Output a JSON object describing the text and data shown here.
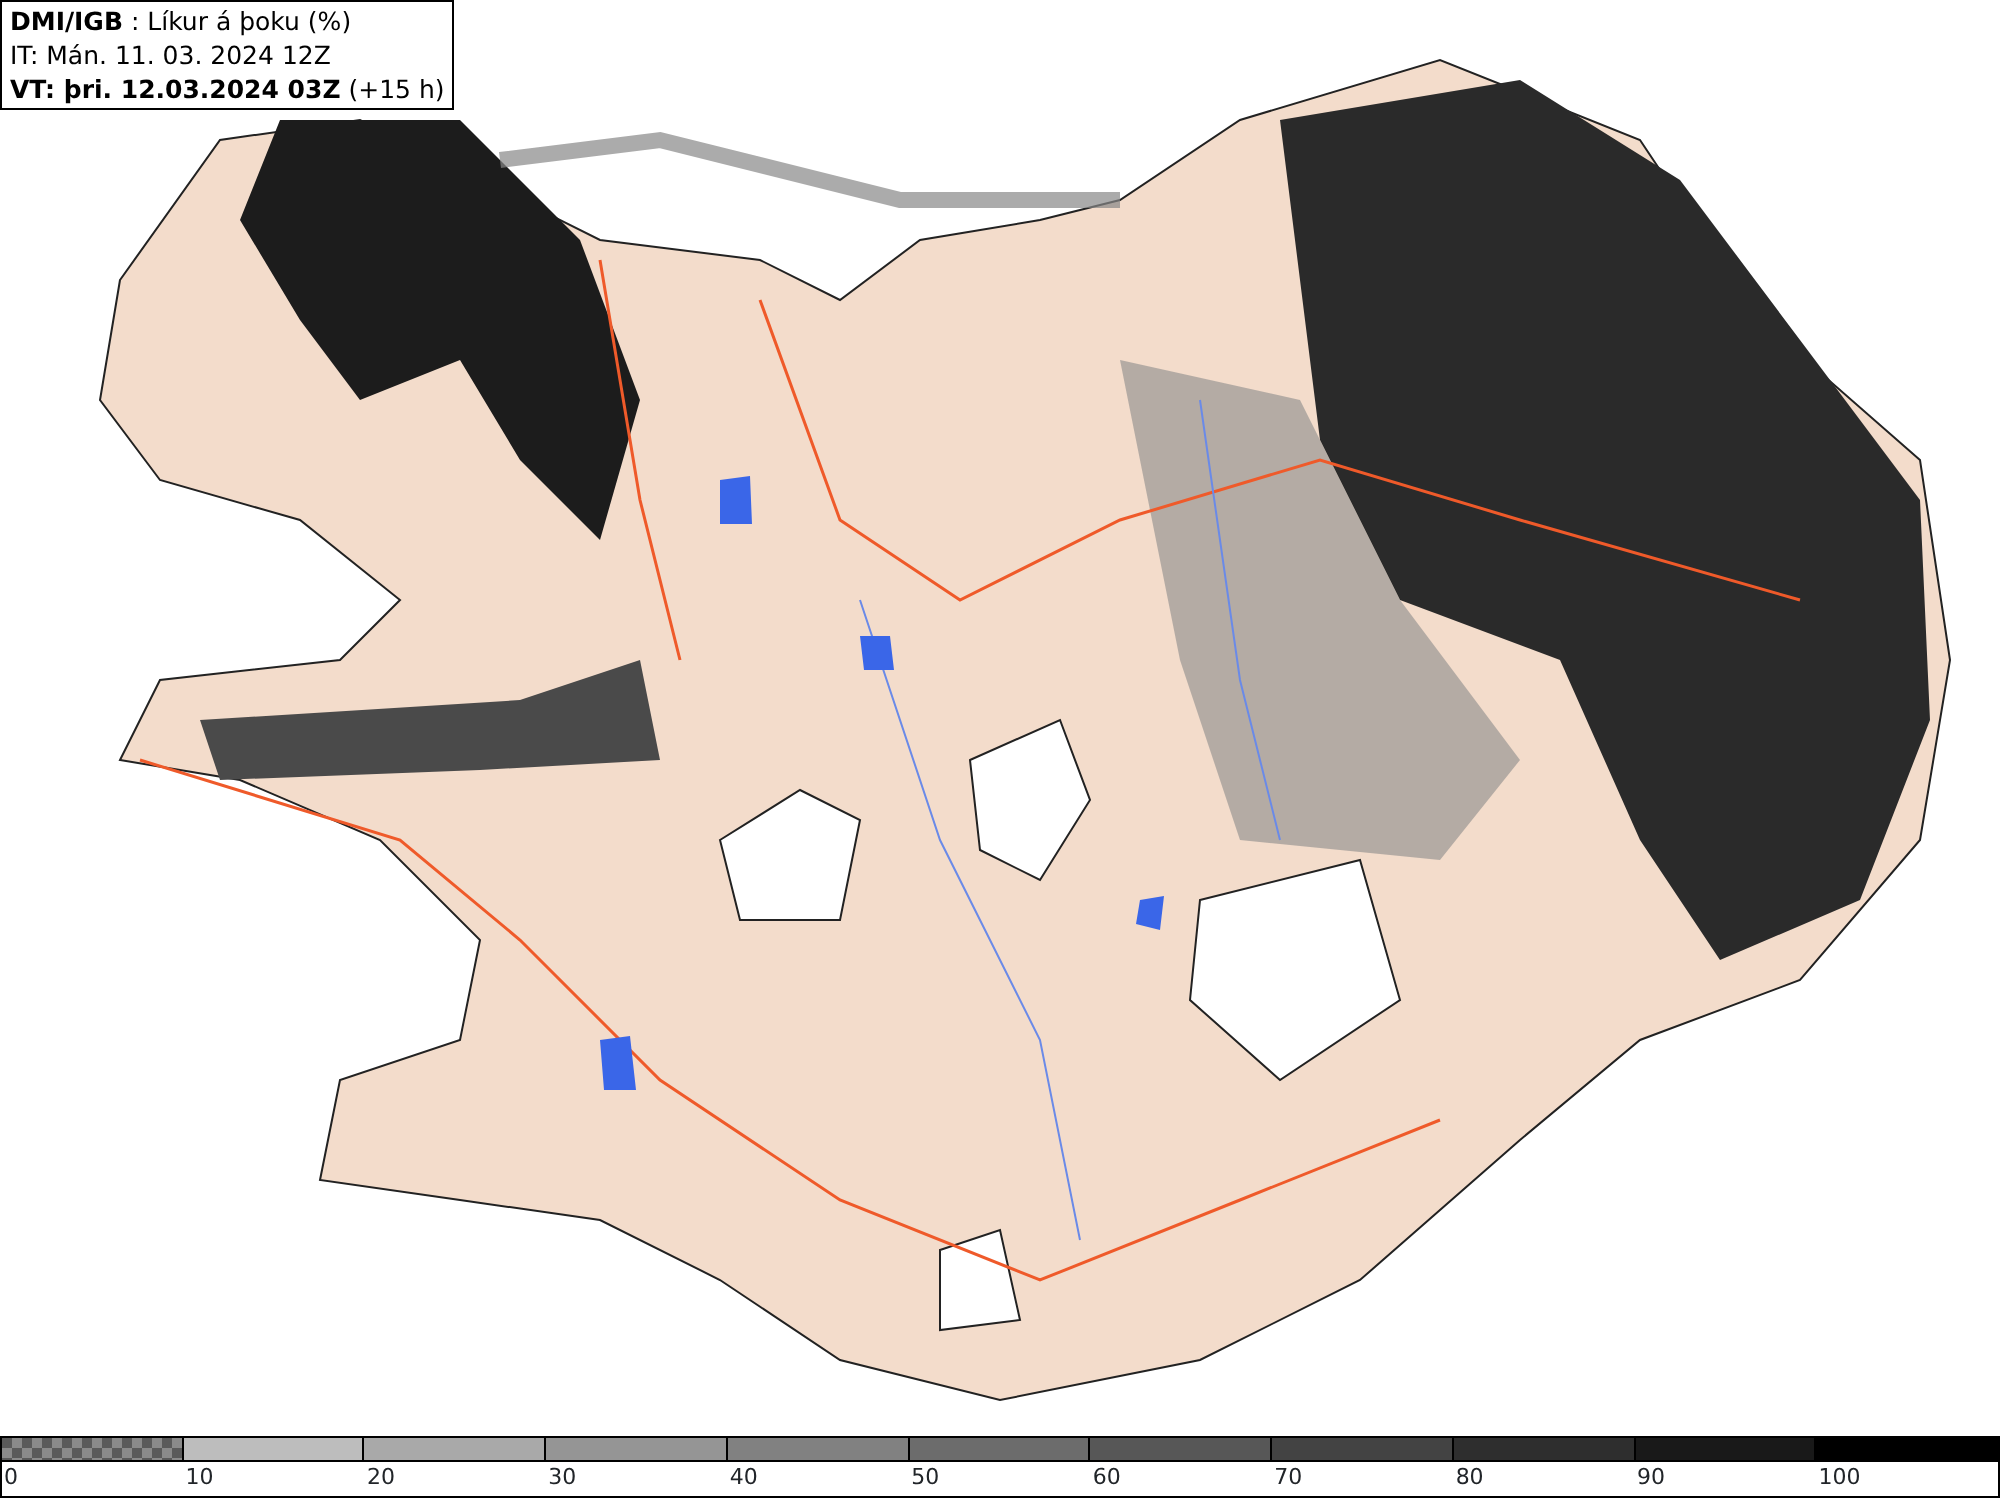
{
  "header": {
    "source": "DMI/IGB",
    "title": ": Líkur á þoku (%)",
    "issue": "IT: Mán. 11. 03. 2024 12Z",
    "valid": "VT: þri. 12.03.2024 03Z",
    "offset": "(+15 h)"
  },
  "legend": {
    "segments": [
      {
        "kind": "checker",
        "color": "#5a5a5a"
      },
      {
        "kind": "solid",
        "color": "#bdbdbd"
      },
      {
        "kind": "solid",
        "color": "#a9a9a9"
      },
      {
        "kind": "solid",
        "color": "#959595"
      },
      {
        "kind": "solid",
        "color": "#818181"
      },
      {
        "kind": "solid",
        "color": "#6c6c6c"
      },
      {
        "kind": "solid",
        "color": "#575757"
      },
      {
        "kind": "solid",
        "color": "#434343"
      },
      {
        "kind": "solid",
        "color": "#2e2e2e"
      },
      {
        "kind": "solid",
        "color": "#191919"
      },
      {
        "kind": "solid",
        "color": "#000000"
      }
    ],
    "labels": [
      "0",
      "10",
      "20",
      "30",
      "40",
      "50",
      "60",
      "70",
      "80",
      "90",
      "100"
    ]
  }
}
